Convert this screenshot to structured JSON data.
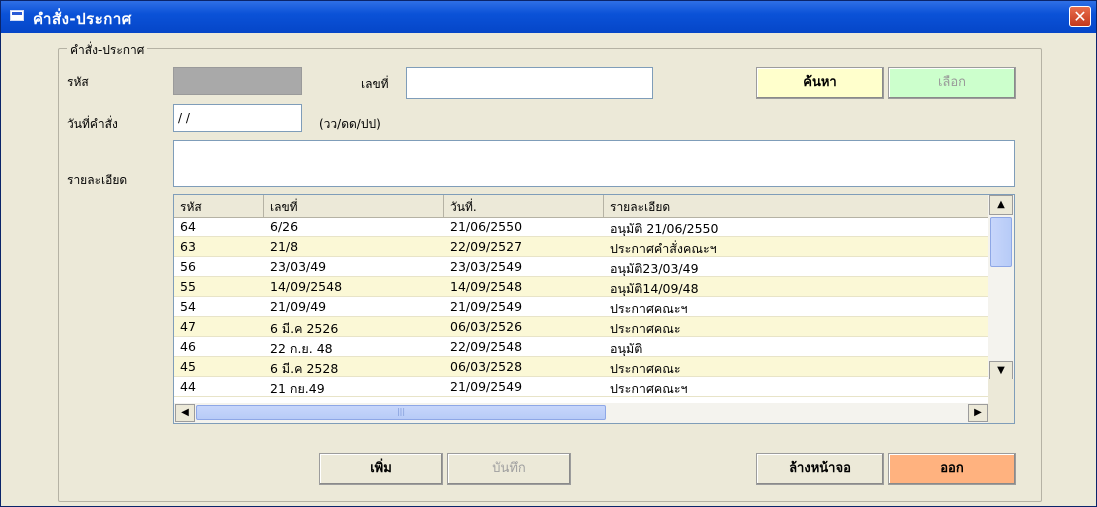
{
  "window": {
    "title": "คำสั่ง-ประกาศ",
    "close_label": "✕"
  },
  "group": {
    "label": "คำสั่ง-ประกาศ"
  },
  "form": {
    "code_label": "รหัส",
    "code_value": "",
    "number_label": "เลขที่",
    "number_value": "",
    "date_label": "วันที่คำสั่ง",
    "date_value": "/ /",
    "date_hint": "(วว/ดด/ปป)",
    "detail_label": "รายละเอียด",
    "detail_value": ""
  },
  "buttons": {
    "search": "ค้นหา",
    "select": "เลือก",
    "add": "เพิ่ม",
    "save": "บันทึก",
    "clear": "ล้างหน้าจอ",
    "exit": "ออก"
  },
  "colors": {
    "search_bg": "#ffffcc",
    "select_bg": "#ccffcc",
    "exit_bg": "#ffb27f"
  },
  "table": {
    "headers": [
      "รหัส",
      "เลขที่",
      "วันที่.",
      "รายละเอียด"
    ],
    "rows": [
      [
        "64",
        "6/26",
        "21/06/2550",
        "อนุมัติ 21/06/2550"
      ],
      [
        "63",
        "21/8",
        "22/09/2527",
        "ประกาศคำสั่งคณะฯ"
      ],
      [
        "56",
        "23/03/49",
        "23/03/2549",
        "อนุมัติ23/03/49"
      ],
      [
        "55",
        "14/09/2548",
        "14/09/2548",
        "อนุมัติ14/09/48"
      ],
      [
        "54",
        "21/09/49",
        "21/09/2549",
        "ประกาศคณะฯ"
      ],
      [
        "47",
        "6 มี.ค 2526",
        "06/03/2526",
        "ประกาศคณะ"
      ],
      [
        "46",
        "22 ก.ย. 48",
        "22/09/2548",
        "อนุมัติ"
      ],
      [
        "45",
        "6 มี.ค 2528",
        "06/03/2528",
        "ประกาศคณะ"
      ],
      [
        "44",
        "21 กย.49",
        "21/09/2549",
        "ประกาศคณะฯ"
      ]
    ]
  }
}
